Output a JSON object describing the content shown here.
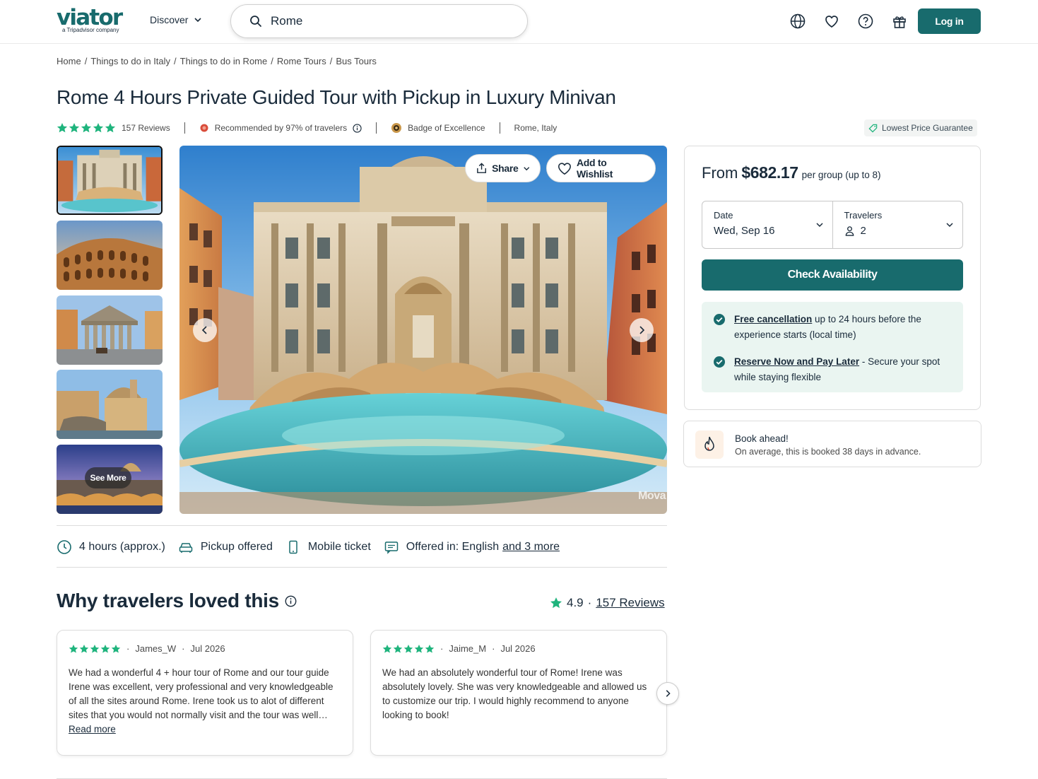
{
  "header": {
    "logo_text": "viator",
    "logo_sub": "a Tripadvisor company",
    "discover_label": "Discover",
    "search_value": "Rome",
    "login_label": "Log in",
    "icons": [
      "globe-icon",
      "heart-icon",
      "help-icon",
      "gift-icon"
    ]
  },
  "breadcrumb": [
    "Home",
    "Things to do in Italy",
    "Things to do in Rome",
    "Rome Tours",
    "Bus Tours"
  ],
  "breadcrumb_sep": "/",
  "title": "Rome 4 Hours Private Guided Tour with Pickup in Luxury Minivan",
  "meta": {
    "rating_stars": 5,
    "reviews_label": "157 Reviews",
    "recommended": "Recommended by 97% of travelers",
    "badge": "Badge of Excellence",
    "location": "Rome, Italy",
    "lowest_price": "Lowest Price Guarantee"
  },
  "gallery": {
    "thumbnails": [
      "Trevi Fountain",
      "Colosseum",
      "Pantheon",
      "Piazza Navona",
      "St. Peter's at dusk"
    ],
    "see_more_label": "See More",
    "share_label": "Share",
    "wishlist_label": "Add to Wishlist",
    "watermark": "Mova"
  },
  "features": {
    "duration": "4 hours (approx.)",
    "pickup": "Pickup offered",
    "ticket": "Mobile ticket",
    "languages_prefix": "Offered in: English",
    "languages_more": "and 3 more"
  },
  "loved": {
    "title": "Why travelers loved this",
    "rating": "4.9",
    "separator": "·",
    "reviews_link": "157 Reviews"
  },
  "reviews": [
    {
      "author": "James_W",
      "date": "Jul 2026",
      "stars": 5,
      "text": "We had a wonderful 4 + hour tour of Rome and our tour guide Irene was excellent, very professional and very knowledgeable of all the sites around Rome. Irene took us to alot of different sites that you would not normally visit and the tour was well worth it.",
      "read_more": "Read more"
    },
    {
      "author": "Jaime_M",
      "date": "Jul 2026",
      "stars": 5,
      "text": "We had an absolutely wonderful tour of Rome! Irene was absolutely lovely. She was very knowledgeable and allowed us to customize our trip. I would highly recommend to anyone looking to book!"
    }
  ],
  "booking": {
    "from_label": "From",
    "price": "$682.17",
    "per_group": "per group (up to 8)",
    "date_label": "Date",
    "date_value": "Wed, Sep 16",
    "travelers_label": "Travelers",
    "travelers_value": "2",
    "check_label": "Check Availability",
    "perk1_link": "Free cancellation",
    "perk1_text": " up to 24 hours before the experience starts (local time)",
    "perk2_link": "Reserve Now and Pay Later",
    "perk2_text": " - Secure your spot while staying flexible"
  },
  "book_ahead": {
    "title": "Book ahead!",
    "subtitle": "On average, this is booked 38 days in advance."
  },
  "colors": {
    "brand": "#186b6d",
    "star": "#1fb47d",
    "perk_bg": "#eaf5f1"
  }
}
